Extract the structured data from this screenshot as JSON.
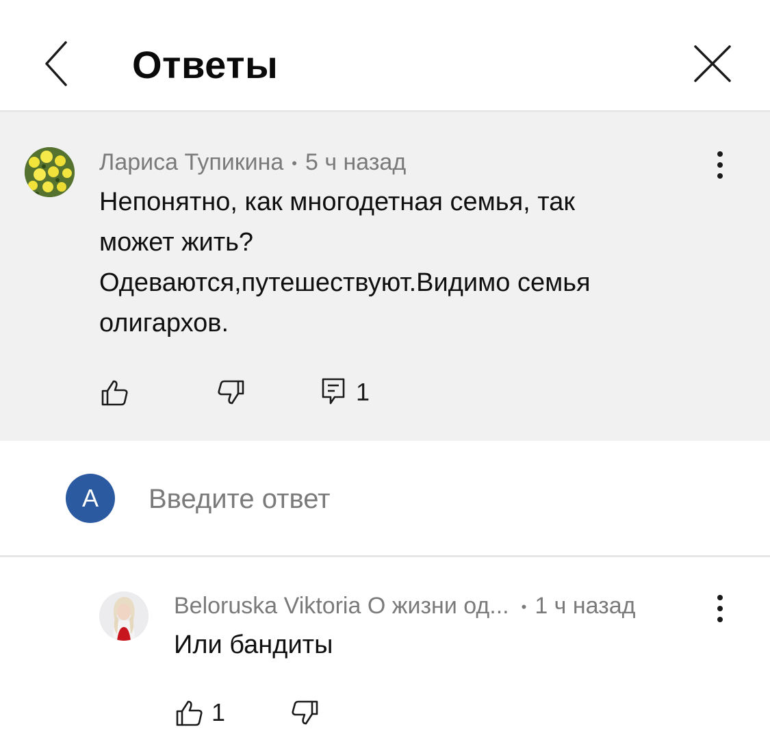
{
  "header": {
    "title": "Ответы"
  },
  "parent_comment": {
    "author": "Лариса Тупикина",
    "time": "5 ч назад",
    "text_lines": [
      "Непонятно, как многодетная семья, так",
      "может жить?",
      "Одеваются,путешествуют.Видимо семья",
      "олигархов."
    ],
    "reply_count": "1"
  },
  "reply_box": {
    "avatar_letter": "A",
    "placeholder": "Введите ответ"
  },
  "replies": [
    {
      "author": "Beloruska Viktoria О жизни од...",
      "time": "1 ч назад",
      "text": "Или бандиты",
      "like_count": "1"
    }
  ],
  "colors": {
    "accent": "#2c5aa0",
    "panel_bg": "#f1f1f1",
    "meta_text": "#7a7a7a"
  }
}
